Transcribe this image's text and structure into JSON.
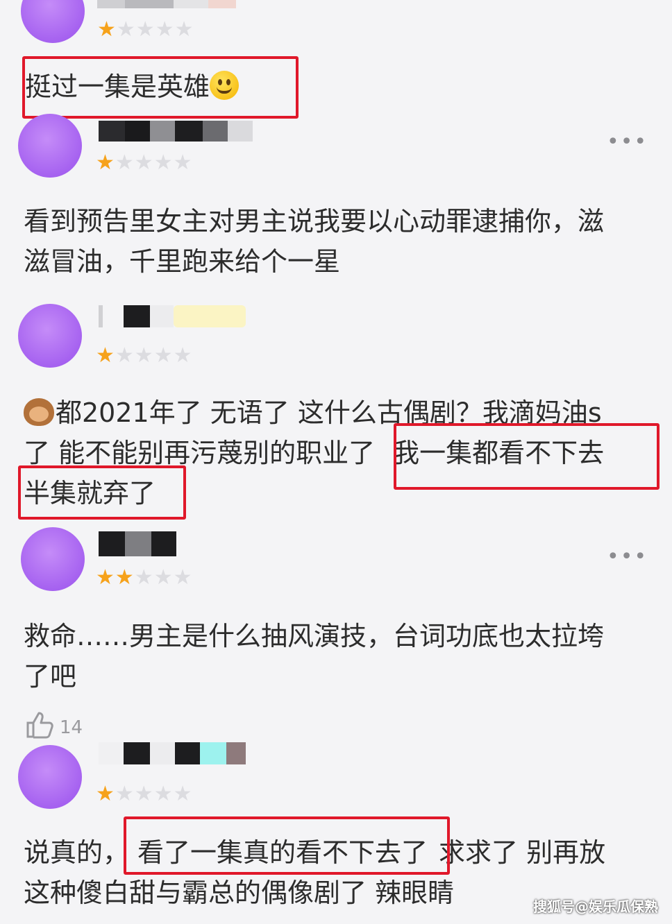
{
  "colors": {
    "avatar": "#a662f0",
    "star_on": "#f6a21b",
    "star_off": "#dcdce0",
    "highlight_box": "#e0182a"
  },
  "comments": [
    {
      "stars": {
        "filled": 1,
        "total": 5
      },
      "text": [
        "挺过一集是英雄"
      ],
      "emoji": "grinning-face-icon"
    },
    {
      "stars": {
        "filled": 1,
        "total": 5
      },
      "more": "•••",
      "text": [
        "看到预告里女主对男主说我要以心动罪逮捕你，滋",
        "滋冒油，千里跑来给个一星"
      ]
    },
    {
      "stars": {
        "filled": 1,
        "total": 5
      },
      "emoji": "see-no-evil-monkey-icon",
      "text": [
        "都2021年了 无语了 这什么古偶剧？我滴妈油s",
        "了 能不能别再污蔑别的职业了 ",
        "我一集都看不下去",
        "半集就弃了"
      ]
    },
    {
      "stars": {
        "filled": 2,
        "total": 5
      },
      "more": "•••",
      "text": [
        "救命……男主是什么抽风演技，台词功底也太拉垮",
        "了吧"
      ],
      "likes": "14"
    },
    {
      "stars": {
        "filled": 1,
        "total": 5
      },
      "text": [
        "说真的，",
        "看了一集真的看不下去了",
        "求求了 别再放",
        "这种傻白甜与霸总的偶像剧了 辣眼睛"
      ]
    }
  ],
  "watermark": "搜狐号@娱乐瓜保熟"
}
